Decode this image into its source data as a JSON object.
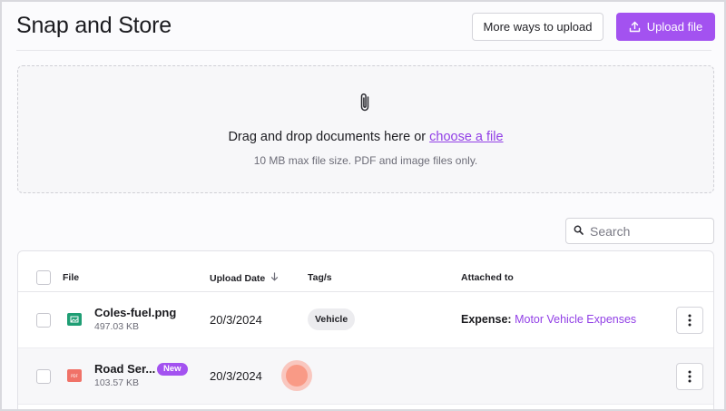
{
  "header": {
    "title": "Snap and Store",
    "more_ways_label": "More ways to upload",
    "upload_label": "Upload file"
  },
  "dropzone": {
    "text": "Drag and drop documents here or",
    "link": "choose a file",
    "subtext": "10 MB max file size. PDF and image files only."
  },
  "search": {
    "placeholder": "Search",
    "value": ""
  },
  "table": {
    "columns": {
      "file": "File",
      "upload_date": "Upload Date",
      "tags": "Tag/s",
      "attached_to": "Attached to"
    },
    "sort_icon": "arrow-down-icon",
    "rows": [
      {
        "name": "Coles-fuel.png",
        "size": "497.03 KB",
        "type_icon": "image-file-icon",
        "date": "20/3/2024",
        "tag": "Vehicle",
        "attached_label": "Expense:",
        "attached_link": "Motor Vehicle Expenses"
      },
      {
        "name": "Road Ser...",
        "size": "103.57 KB",
        "type_icon": "pdf-file-icon",
        "badge": "New",
        "date": "20/3/2024",
        "tag": "",
        "attached_label": "",
        "attached_link": ""
      }
    ]
  },
  "colors": {
    "accent": "#a352f0",
    "link": "#9240e6",
    "image_icon": "#1f9e74",
    "pdf_icon": "#f07268"
  }
}
